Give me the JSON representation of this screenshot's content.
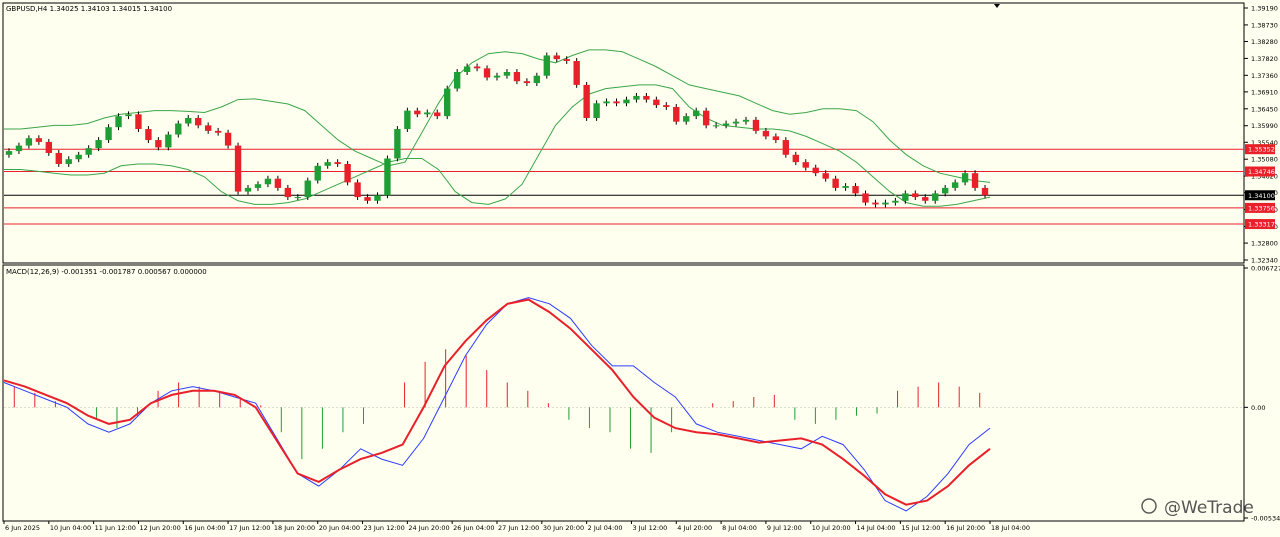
{
  "chart_data": [
    {
      "type": "candlestick",
      "title": "GBPUSD,H4  1.34025 1.34103 1.34015 1.34100",
      "symbol": "GBPUSD",
      "timeframe": "H4",
      "ohlc_header": "1.34025 1.34103 1.34015 1.34100",
      "ylim": [
        1.3234,
        1.3919
      ],
      "y_ticks": [
        "1.39190",
        "1.38730",
        "1.38280",
        "1.37820",
        "1.37360",
        "1.36910",
        "1.36450",
        "1.35990",
        "1.35540",
        "1.35080",
        "1.34620",
        "1.34170",
        "1.33710",
        "1.33250",
        "1.32800",
        "1.32340"
      ],
      "x_ticks": [
        "6 Jun 2025",
        "10 Jun 04:00",
        "11 Jun 12:00",
        "12 Jun 20:00",
        "16 Jun 04:00",
        "17 Jun 12:00",
        "18 Jun 20:00",
        "20 Jun 04:00",
        "23 Jun 12:00",
        "24 Jun 20:00",
        "26 Jun 04:00",
        "27 Jun 12:00",
        "30 Jun 20:00",
        "2 Jul 04:00",
        "3 Jul 12:00",
        "4 Jul 20:00",
        "8 Jul 04:00",
        "9 Jul 12:00",
        "10 Jul 20:00",
        "14 Jul 04:00",
        "15 Jul 12:00",
        "16 Jul 20:00",
        "18 Jul 04:00"
      ],
      "horizontal_levels": [
        {
          "label": "1.35352",
          "value": 1.35352,
          "color": "#e8202a"
        },
        {
          "label": "1.34746",
          "value": 1.34746,
          "color": "#e8202a"
        },
        {
          "label": "1.34100",
          "value": 1.341,
          "color": "#000000"
        },
        {
          "label": "1.33756",
          "value": 1.33756,
          "color": "#e8202a"
        },
        {
          "label": "1.33317",
          "value": 1.33317,
          "color": "#e8202a"
        }
      ],
      "price_series": [
        1.353,
        1.3545,
        1.3565,
        1.3555,
        1.3525,
        1.3495,
        1.3508,
        1.352,
        1.3538,
        1.356,
        1.3595,
        1.3625,
        1.363,
        1.359,
        1.356,
        1.354,
        1.3575,
        1.3605,
        1.362,
        1.36,
        1.3585,
        1.358,
        1.3545,
        1.342,
        1.343,
        1.344,
        1.3455,
        1.343,
        1.3405,
        1.3405,
        1.345,
        1.349,
        1.35,
        1.3495,
        1.3445,
        1.3405,
        1.3395,
        1.341,
        1.351,
        1.359,
        1.364,
        1.363,
        1.3635,
        1.3625,
        1.37,
        1.3745,
        1.376,
        1.3755,
        1.373,
        1.3735,
        1.3745,
        1.372,
        1.3715,
        1.3735,
        1.379,
        1.378,
        1.3775,
        1.371,
        1.362,
        1.366,
        1.3665,
        1.366,
        1.367,
        1.368,
        1.367,
        1.3655,
        1.365,
        1.361,
        1.3625,
        1.364,
        1.36,
        1.36,
        1.3605,
        1.361,
        1.3615,
        1.3585,
        1.357,
        1.356,
        1.352,
        1.35,
        1.3485,
        1.347,
        1.3455,
        1.343,
        1.3435,
        1.3415,
        1.339,
        1.3385,
        1.339,
        1.3395,
        1.3415,
        1.3405,
        1.3395,
        1.3415,
        1.343,
        1.3445,
        1.347,
        1.343,
        1.341
      ],
      "bollinger_upper": [
        1.359,
        1.359,
        1.3595,
        1.36,
        1.36,
        1.3605,
        1.362,
        1.363,
        1.3635,
        1.364,
        1.364,
        1.3638,
        1.3635,
        1.365,
        1.367,
        1.3672,
        1.3665,
        1.3658,
        1.364,
        1.36,
        1.356,
        1.353,
        1.351,
        1.349,
        1.35,
        1.358,
        1.366,
        1.373,
        1.377,
        1.3795,
        1.38,
        1.3795,
        1.378,
        1.377,
        1.379,
        1.3805,
        1.3805,
        1.38,
        1.378,
        1.376,
        1.3735,
        1.371,
        1.37,
        1.369,
        1.368,
        1.366,
        1.364,
        1.363,
        1.3635,
        1.3645,
        1.3645,
        1.364,
        1.361,
        1.356,
        1.352,
        1.349,
        1.347,
        1.346,
        1.345,
        1.3445
      ],
      "bollinger_lower": [
        1.348,
        1.348,
        1.3475,
        1.347,
        1.3465,
        1.3465,
        1.347,
        1.349,
        1.3495,
        1.3495,
        1.349,
        1.348,
        1.346,
        1.342,
        1.3395,
        1.3385,
        1.3385,
        1.339,
        1.34,
        1.342,
        1.344,
        1.346,
        1.348,
        1.35,
        1.351,
        1.351,
        1.348,
        1.342,
        1.339,
        1.3385,
        1.34,
        1.344,
        1.352,
        1.36,
        1.365,
        1.3685,
        1.37,
        1.3705,
        1.371,
        1.371,
        1.37,
        1.365,
        1.362,
        1.36,
        1.3595,
        1.359,
        1.359,
        1.3585,
        1.357,
        1.355,
        1.353,
        1.35,
        1.346,
        1.342,
        1.339,
        1.338,
        1.338,
        1.3385,
        1.3395,
        1.3405
      ]
    },
    {
      "type": "line",
      "title": "MACD(12,26,9) -0.001351 -0.001787 0.000567 0.000000",
      "indicator": "MACD(12,26,9)",
      "values_header": "-0.001351 -0.001787 0.000567 0.000000",
      "ylim": [
        -0.005342,
        0.006727
      ],
      "y_ticks": [
        "0.006727",
        "0.00",
        "-0.005342"
      ],
      "series": [
        {
          "color": "#2d3cff",
          "values": [
            0.0012,
            0.0008,
            0.0004,
            0.0,
            -0.0008,
            -0.0012,
            -0.0008,
            0.0002,
            0.0008,
            0.001,
            0.0008,
            0.0005,
            0.0002,
            -0.0015,
            -0.0032,
            -0.0038,
            -0.003,
            -0.002,
            -0.0025,
            -0.0028,
            -0.0015,
            0.0005,
            0.0025,
            0.004,
            0.005,
            0.0053,
            0.005,
            0.0043,
            0.003,
            0.002,
            0.002,
            0.0012,
            0.0005,
            -0.0008,
            -0.0012,
            -0.0014,
            -0.0016,
            -0.0018,
            -0.002,
            -0.0014,
            -0.0018,
            -0.003,
            -0.0045,
            -0.005,
            -0.0043,
            -0.0032,
            -0.0018,
            -0.001
          ]
        },
        {
          "color": "#e8202a",
          "values": [
            0.0013,
            0.001,
            0.0006,
            0.0002,
            -0.0004,
            -0.0008,
            -0.0006,
            0.0002,
            0.0006,
            0.0008,
            0.0008,
            0.0006,
            0.0,
            -0.0016,
            -0.0032,
            -0.0036,
            -0.003,
            -0.0025,
            -0.0022,
            -0.0018,
            0.0,
            0.002,
            0.0032,
            0.0042,
            0.005,
            0.0052,
            0.0046,
            0.0038,
            0.0028,
            0.0018,
            0.0005,
            -0.0005,
            -0.001,
            -0.0012,
            -0.0013,
            -0.0015,
            -0.0017,
            -0.0016,
            -0.0015,
            -0.0018,
            -0.0025,
            -0.0033,
            -0.0042,
            -0.0047,
            -0.0045,
            -0.0038,
            -0.0028,
            -0.002
          ]
        }
      ],
      "histogram": [
        0.001,
        0.0007,
        0.0003,
        -0.0001,
        -0.0006,
        -0.001,
        -0.0004,
        0.0008,
        0.0012,
        0.001,
        0.0007,
        0.0004,
        0.0001,
        -0.0012,
        -0.0025,
        -0.002,
        -0.0012,
        -0.0008,
        0.0,
        0.0012,
        0.0022,
        0.0028,
        0.0025,
        0.0018,
        0.0012,
        0.0008,
        0.0002,
        -0.0006,
        -0.001,
        -0.0012,
        -0.002,
        -0.0022,
        -0.0012,
        0.0,
        0.0002,
        0.0003,
        0.0005,
        0.0006,
        -0.0006,
        -0.0008,
        -0.0006,
        -0.0004,
        -0.0003,
        0.0008,
        0.001,
        0.0012,
        0.001,
        0.0007
      ],
      "histogram_colors": {
        "up": "#e8202a",
        "down": "#1e9e35"
      }
    }
  ],
  "watermark": "@WeTrade"
}
